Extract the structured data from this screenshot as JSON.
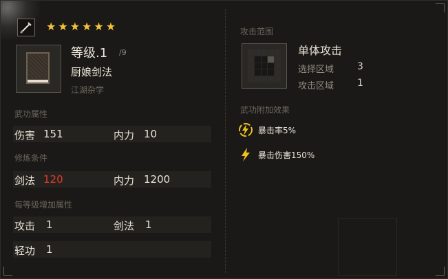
{
  "skill": {
    "stars": [
      "★",
      "★",
      "★",
      "★",
      "★",
      "★"
    ],
    "level_text": "等级.1",
    "level_max": "/9",
    "name": "厨娘剑法",
    "school": "江湖杂学"
  },
  "sections": {
    "attributes_title": "武功属性",
    "requirements_title": "修炼条件",
    "per_level_title": "每等级增加属性"
  },
  "attributes": {
    "damage_label": "伤害",
    "damage_value": "151",
    "neili_label": "内力",
    "neili_value": "10"
  },
  "requirements": {
    "sword_label": "剑法",
    "sword_value": "120",
    "neili_label": "内力",
    "neili_value": "1200"
  },
  "per_level": {
    "attack_label": "攻击",
    "attack_value": "1",
    "sword_label": "剑法",
    "sword_value": "1",
    "qinggong_label": "轻功",
    "qinggong_value": "1"
  },
  "range": {
    "title": "攻击范围",
    "attack_type": "单体攻击",
    "select_label": "选择区域",
    "select_value": "3",
    "attack_area_label": "攻击区域",
    "attack_area_value": "1"
  },
  "effects": {
    "title": "武功附加效果",
    "items": [
      "暴击率5%",
      "暴击伤害150%"
    ]
  },
  "colors": {
    "star": "#f3c43a",
    "requirement_unmet": "#e23a2c",
    "effect_icon": "#f0c21c"
  }
}
